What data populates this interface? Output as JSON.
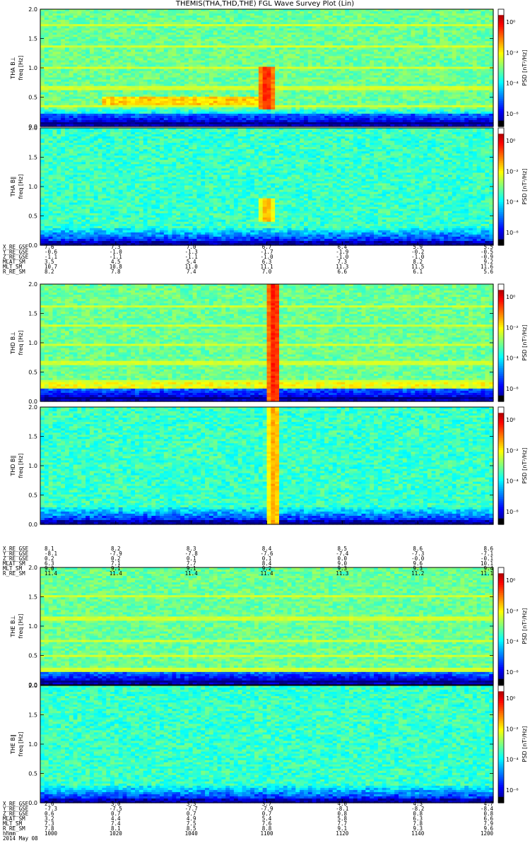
{
  "title": "THEMIS(THA,THD,THE) FGL Wave Survey Plot (Lin)",
  "colorbar_label": "PSD [nT²/Hz]",
  "colorbar_ticks": [
    "10⁰",
    "10⁻²",
    "10⁻⁴",
    "10⁻⁶"
  ],
  "freq_ticks": [
    "2.0",
    "1.5",
    "1.0",
    "0.5",
    "0.0"
  ],
  "chart_data": [
    {
      "type": "heatmap",
      "probe": "THA",
      "component": "B⊥",
      "ylabel": "THA B⊥",
      "ylabel2": "freq [Hz]",
      "ylim": [
        0,
        2.0
      ],
      "features": {
        "bands_hz": [
          1.72,
          1.36,
          1.0,
          0.66,
          0.34
        ],
        "burst_time": "1100",
        "burst_freq_hz": [
          0.3,
          1.0
        ]
      }
    },
    {
      "type": "heatmap",
      "probe": "THA",
      "component": "B∥",
      "ylabel": "THA B∥",
      "ylabel2": "freq [Hz]",
      "ylim": [
        0,
        2.0
      ],
      "features": {
        "burst_time": "1100",
        "burst_freq_hz": [
          0.4,
          0.8
        ]
      }
    },
    {
      "type": "heatmap",
      "probe": "THD",
      "component": "B⊥",
      "ylabel": "THD B⊥",
      "ylabel2": "freq [Hz]",
      "ylim": [
        0,
        2.0
      ],
      "features": {
        "bands_hz": [
          1.62,
          1.3,
          0.97,
          0.65,
          0.33
        ],
        "burst_time": "1102",
        "burst_freq_hz": [
          0,
          2.0
        ]
      }
    },
    {
      "type": "heatmap",
      "probe": "THD",
      "component": "B∥",
      "ylabel": "THD B∥",
      "ylabel2": "freq [Hz]",
      "ylim": [
        0,
        2.0
      ],
      "features": {
        "burst_time": "1102",
        "burst_freq_hz": [
          0,
          2.0
        ]
      }
    },
    {
      "type": "heatmap",
      "probe": "THE",
      "component": "B⊥",
      "ylabel": "THE B⊥",
      "ylabel2": "freq [Hz]",
      "ylim": [
        0,
        2.0
      ],
      "features": {
        "bands_hz": [
          1.5,
          1.13,
          0.75,
          0.5,
          0.26
        ]
      }
    },
    {
      "type": "heatmap",
      "probe": "THE",
      "component": "B∥",
      "ylabel": "THE B∥",
      "ylabel2": "freq [Hz]",
      "ylim": [
        0,
        2.0
      ],
      "features": {}
    }
  ],
  "orbit_tables": [
    {
      "rows": [
        {
          "label": "X_RE_GSE",
          "values": [
            "7.6",
            "7.3",
            "7.0",
            "6.7",
            "6.4",
            "5.9",
            "5.5"
          ]
        },
        {
          "label": "Y_RE_GSE",
          "values": [
            "-0.6",
            "-1.0",
            "-1.3",
            "-1.7",
            "-1.9",
            "-0.2",
            "-0.5"
          ]
        },
        {
          "label": "Z_RE_GSE",
          "values": [
            "-1.1",
            "-1.1",
            "-1.1",
            "-1.0",
            "-1.0",
            "-1.0",
            "-0.9"
          ]
        },
        {
          "label": "MLAT_SM",
          "values": [
            "3.5",
            "4.5",
            "5.4",
            "6.3",
            "7.3",
            "8.2",
            "9.2"
          ]
        },
        {
          "label": "MLT_SM",
          "values": [
            "10.7",
            "10.8",
            "11.0",
            "11.1",
            "11.3",
            "11.5",
            "11.6"
          ]
        },
        {
          "label": "R_RE_SM",
          "values": [
            "8.2",
            "7.8",
            "7.4",
            "7.0",
            "6.6",
            "6.1",
            "5.6"
          ]
        }
      ]
    },
    {
      "rows": [
        {
          "label": "X_RE_GSE",
          "values": [
            "8.1",
            "8.2",
            "8.3",
            "8.4",
            "8.5",
            "8.6",
            "8.6"
          ]
        },
        {
          "label": "Y_RE_GSE",
          "values": [
            "-8.1",
            "-7.9",
            "-7.8",
            "-7.6",
            "-7.4",
            "-7.3",
            "-7.1"
          ]
        },
        {
          "label": "Z_RE_GSE",
          "values": [
            "0.2",
            "0.2",
            "0.1",
            "0.1",
            "0.0",
            "-0.0",
            "-0.1"
          ]
        },
        {
          "label": "MLAT_SM",
          "values": [
            "6.3",
            "7.1",
            "7.7",
            "8.4",
            "9.0",
            "9.6",
            "10.1"
          ]
        },
        {
          "label": "MLT_SM",
          "values": [
            "9.0",
            "9.1",
            "9.1",
            "9.2",
            "9.3",
            "9.3",
            "9.4"
          ]
        },
        {
          "label": "R_RE_SM",
          "values": [
            "11.4",
            "11.4",
            "11.4",
            "11.4",
            "11.3",
            "11.2",
            "11.1"
          ]
        }
      ]
    },
    {
      "rows": [
        {
          "label": "X_RE_GSE",
          "values": [
            "2.6",
            "3.0",
            "3.3",
            "3.7",
            "4.0",
            "4.3",
            "4.7"
          ]
        },
        {
          "label": "Y_RE_GSE",
          "values": [
            "-7.3",
            "-7.5",
            "-7.7",
            "-7.9",
            "-8.1",
            "-8.2",
            "-8.4"
          ]
        },
        {
          "label": "Z_RE_GSE",
          "values": [
            "0.6",
            "0.7",
            "0.7",
            "0.7",
            "0.8",
            "0.8",
            "0.8"
          ]
        },
        {
          "label": "MLAT_SM",
          "values": [
            "3.2",
            "4.4",
            "4.9",
            "5.4",
            "5.8",
            "6.3",
            "6.6"
          ]
        },
        {
          "label": "MLT_SM",
          "values": [
            "7.3",
            "7.4",
            "7.5",
            "7.6",
            "7.7",
            "7.8",
            "7.9"
          ]
        },
        {
          "label": "R_RE_SM",
          "values": [
            "7.8",
            "8.1",
            "8.5",
            "8.8",
            "9.1",
            "9.3",
            "9.6"
          ]
        },
        {
          "label": "hhmm",
          "values": [
            "1000",
            "1020",
            "1040",
            "1100",
            "1120",
            "1140",
            "1200"
          ]
        }
      ],
      "date": "2014 May 08"
    }
  ]
}
